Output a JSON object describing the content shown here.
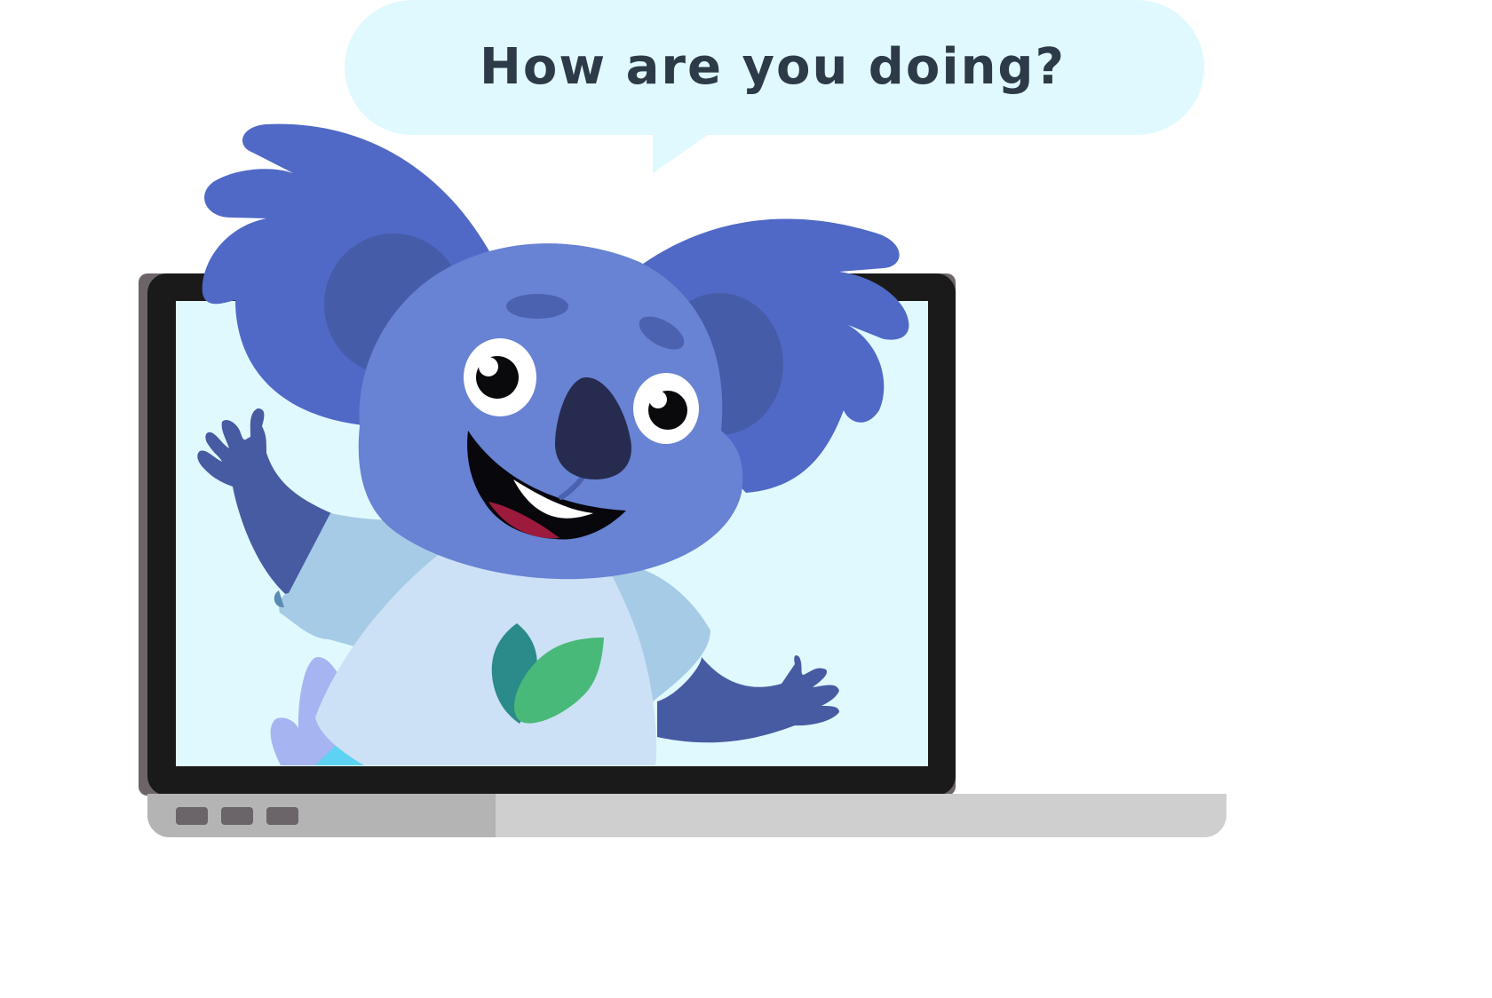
{
  "speech_bubble": {
    "text": "How are you doing?"
  },
  "colors": {
    "bubble": "#e0f9fe",
    "screen_bg": "#e0f9fe",
    "laptop_frame": "#1a1a1a",
    "laptop_base": "#cfcfcf",
    "koala_fur": "#6882d4",
    "koala_ear": "#5069c6",
    "koala_nose": "#272b4f",
    "shirt": "#cce1f5",
    "leaf_green": "#48b978",
    "leaf_teal": "#2b8a8a"
  },
  "icons": [
    "speech-bubble-icon",
    "laptop-icon",
    "koala-mascot-icon",
    "leaf-icon"
  ]
}
